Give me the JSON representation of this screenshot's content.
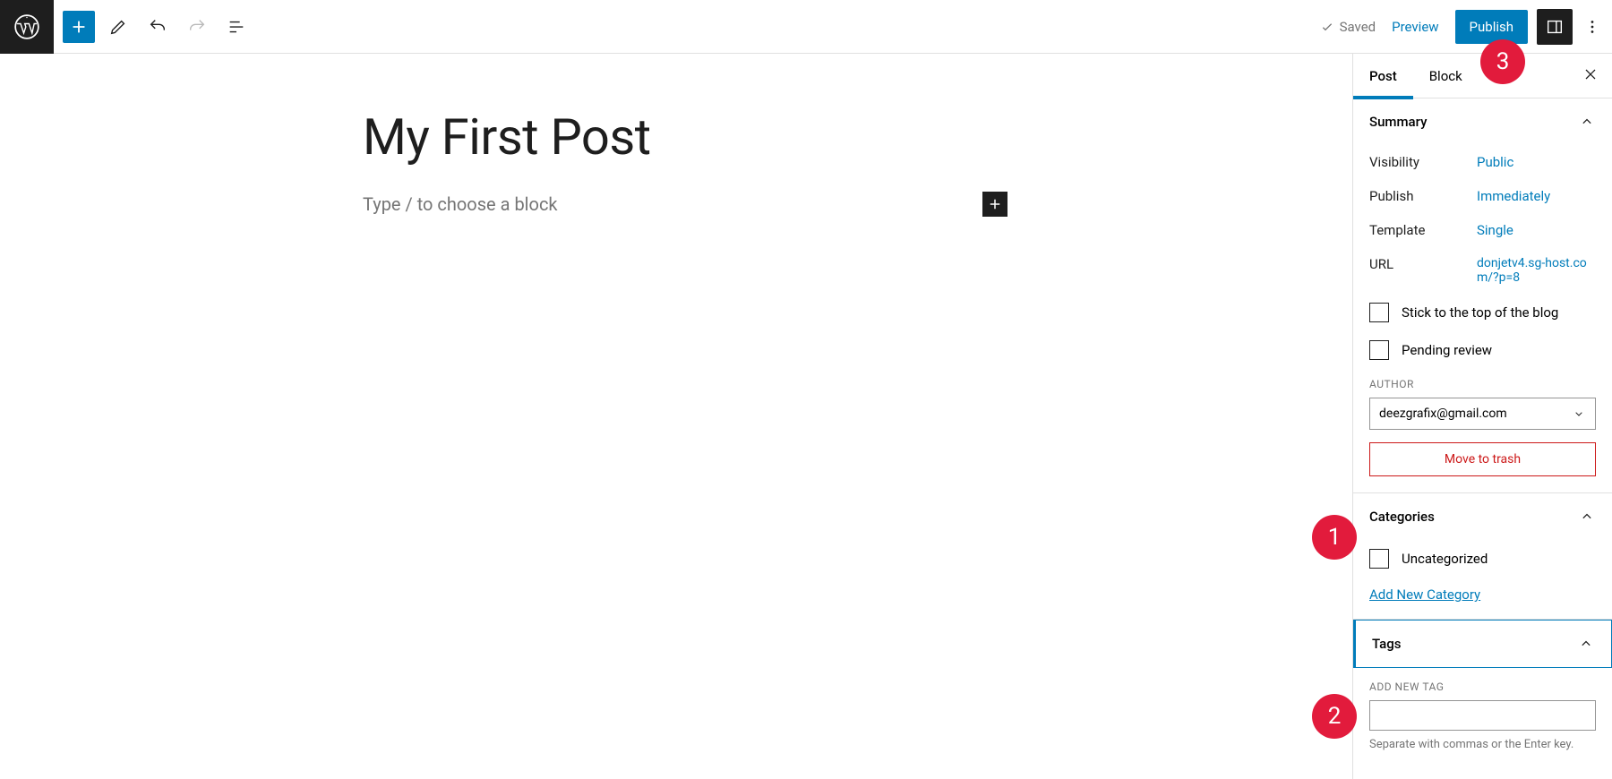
{
  "toolbar": {
    "saved_label": "Saved",
    "preview_label": "Preview",
    "publish_label": "Publish"
  },
  "editor": {
    "post_title": "My First Post",
    "block_placeholder": "Type / to choose a block"
  },
  "sidebar": {
    "tabs": {
      "post": "Post",
      "block": "Block"
    },
    "summary": {
      "title": "Summary",
      "visibility_label": "Visibility",
      "visibility_value": "Public",
      "publish_label": "Publish",
      "publish_value": "Immediately",
      "template_label": "Template",
      "template_value": "Single",
      "url_label": "URL",
      "url_value": "donjetv4.sg-host.com/?p=8",
      "sticky_label": "Stick to the top of the blog",
      "pending_label": "Pending review",
      "author_label": "AUTHOR",
      "author_value": "deezgrafix@gmail.com",
      "trash_label": "Move to trash"
    },
    "categories": {
      "title": "Categories",
      "uncategorized": "Uncategorized",
      "add_new": "Add New Category"
    },
    "tags": {
      "title": "Tags",
      "add_label": "ADD NEW TAG",
      "hint": "Separate with commas or the Enter key."
    }
  },
  "markers": {
    "m1": "1",
    "m2": "2",
    "m3": "3"
  }
}
